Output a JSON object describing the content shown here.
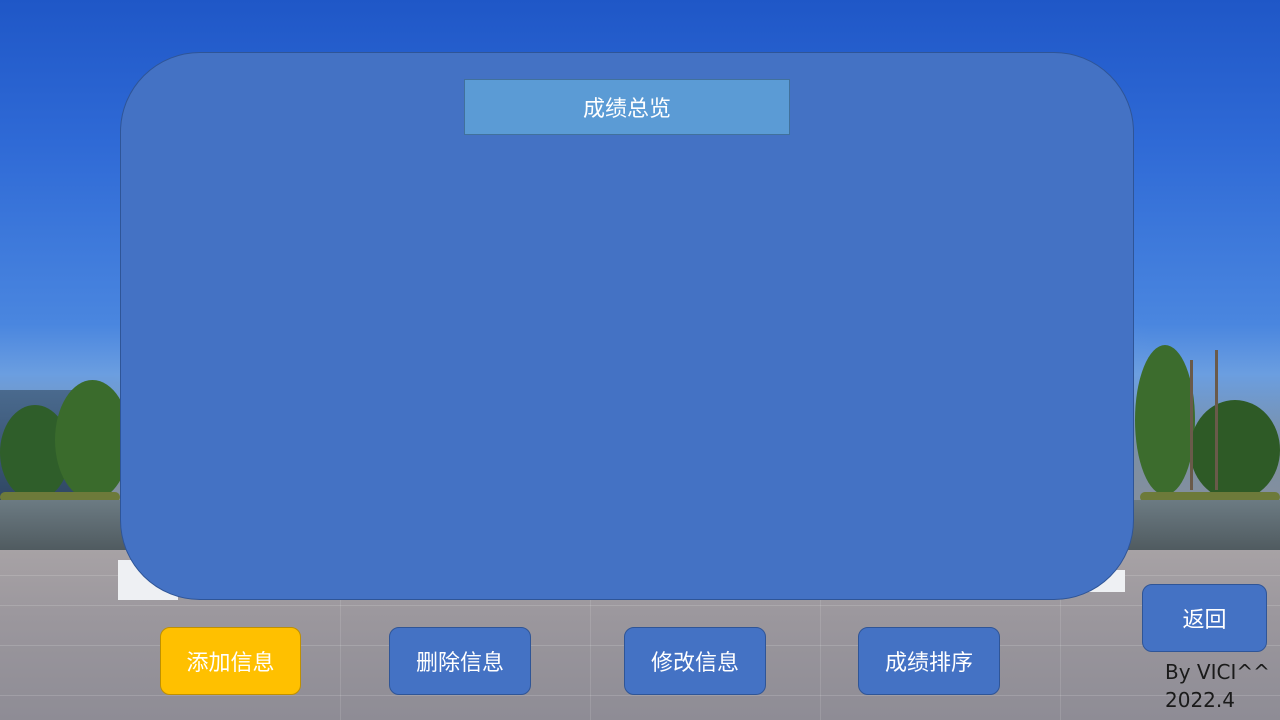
{
  "panel": {
    "title": "成绩总览"
  },
  "buttons": {
    "add": "添加信息",
    "delete": "删除信息",
    "edit": "修改信息",
    "sort": "成绩排序",
    "back": "返回"
  },
  "credit": {
    "author": "By VICI^^",
    "date": "2022.4"
  },
  "colors": {
    "panel": "#4472c4",
    "title_bar": "#5b9bd5",
    "add_button": "#ffc000",
    "button": "#4472c4"
  }
}
